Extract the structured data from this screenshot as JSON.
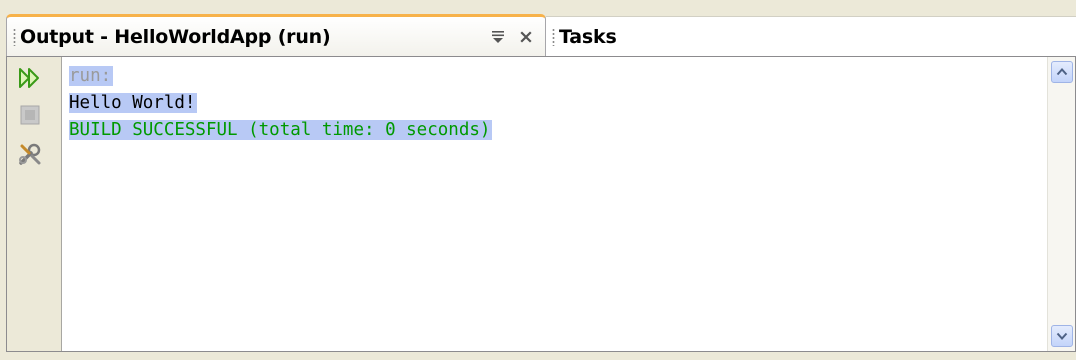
{
  "tabs": {
    "output_title": "Output - HelloWorldApp (run)",
    "tasks_title": "Tasks",
    "minimize_icon": "minimize-icon",
    "close_icon": "close-icon"
  },
  "toolbar": {
    "rerun_icon": "rerun-icon",
    "stop_icon": "stop-icon",
    "settings_icon": "tools-icon"
  },
  "output_lines": [
    "run:",
    "Hello World!",
    "BUILD SUCCESSFUL (total time: 0 seconds)"
  ],
  "colors": {
    "tab_accent": "#f7b24a",
    "selection": "#b8c9f5",
    "run_text": "#9a9a9a",
    "success_text": "#009900"
  }
}
